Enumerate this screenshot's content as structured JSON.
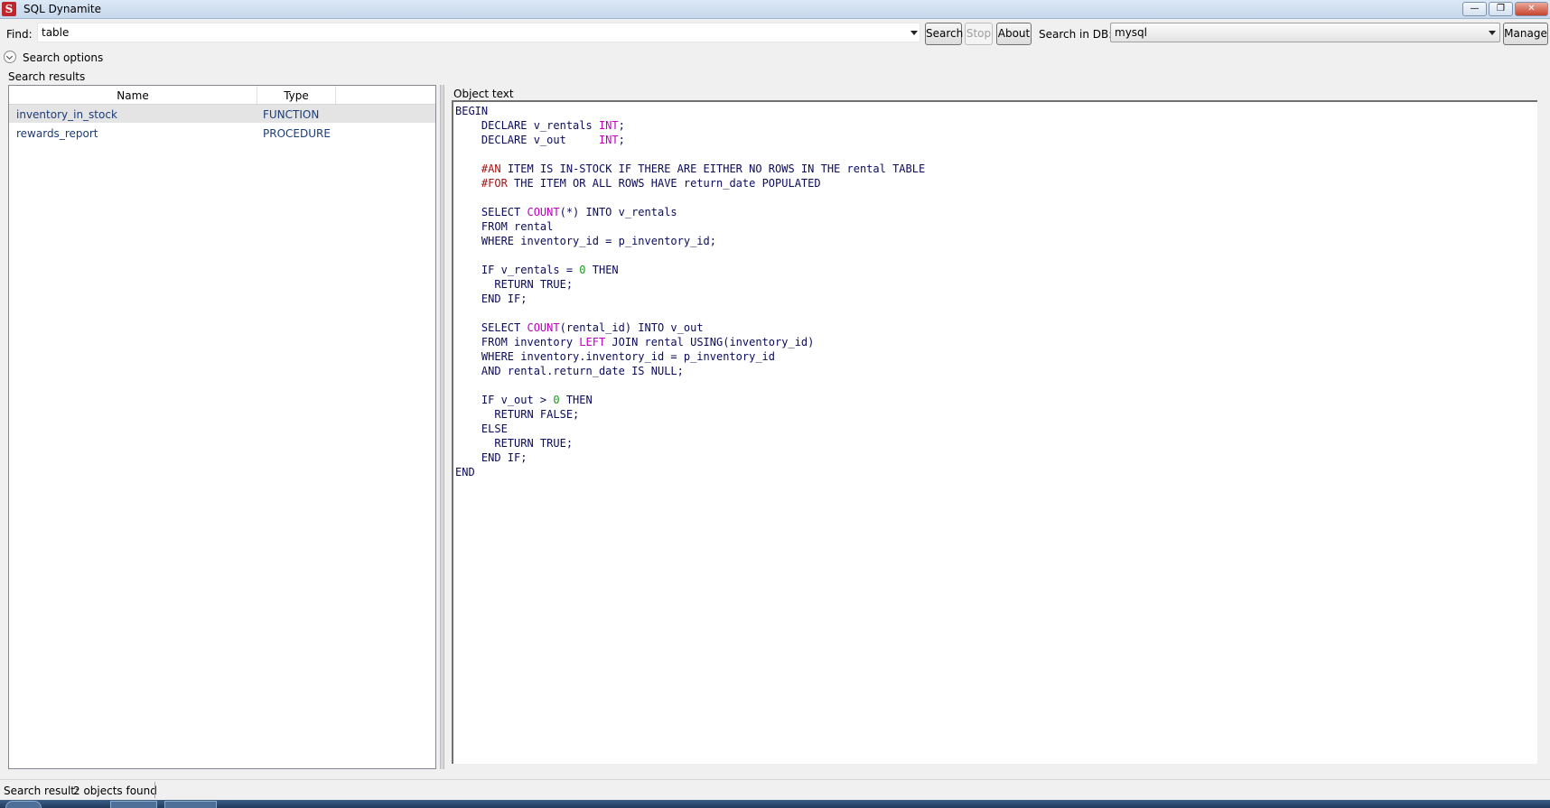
{
  "window": {
    "title": "SQL Dynamite",
    "app_icon_letter": "S"
  },
  "toolbar": {
    "find_label": "Find:",
    "find_value": "table",
    "search_button": "Search",
    "stop_button": "Stop",
    "about_button": "About",
    "db_label": "Search in DB:",
    "db_value": "mysql",
    "manage_button": "Manage"
  },
  "options": {
    "label": "Search options"
  },
  "results": {
    "label": "Search results",
    "columns": {
      "name": "Name",
      "type": "Type"
    },
    "rows": [
      {
        "name": "inventory_in_stock",
        "type": "FUNCTION"
      },
      {
        "name": "rewards_report",
        "type": "PROCEDURE"
      }
    ]
  },
  "object_text": {
    "label": "Object text",
    "code": "BEGIN\n    DECLARE v_rentals INT;\n    DECLARE v_out     INT;\n\n    #AN ITEM IS IN-STOCK IF THERE ARE EITHER NO ROWS IN THE rental TABLE\n    #FOR THE ITEM OR ALL ROWS HAVE return_date POPULATED\n\n    SELECT COUNT(*) INTO v_rentals\n    FROM rental\n    WHERE inventory_id = p_inventory_id;\n\n    IF v_rentals = 0 THEN\n      RETURN TRUE;\n    END IF;\n\n    SELECT COUNT(rental_id) INTO v_out\n    FROM inventory LEFT JOIN rental USING(inventory_id)\n    WHERE inventory.inventory_id = p_inventory_id\n    AND rental.return_date IS NULL;\n\n    IF v_out > 0 THEN\n      RETURN FALSE;\n    ELSE\n      RETURN TRUE;\n    END IF;\nEND"
  },
  "status": {
    "label": "Search result:",
    "value": "2 objects found"
  },
  "colors": {
    "comment": "#a31515",
    "function": "#c000c0",
    "number": "#1a9a1a",
    "keyword": "#0b0b5e"
  }
}
